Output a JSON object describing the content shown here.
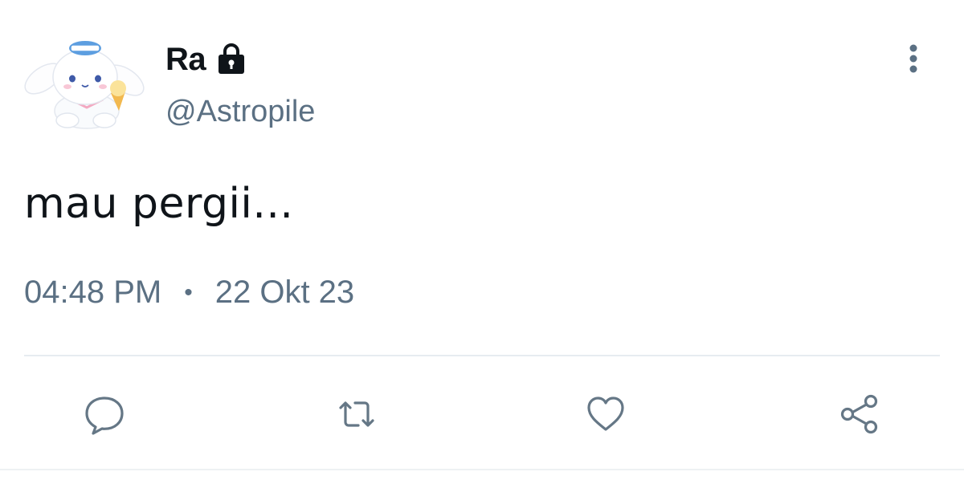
{
  "tweet": {
    "author": {
      "display_name": "Ra",
      "handle": "@Astropile",
      "avatar_icon": "cinnamoroll-avatar",
      "protected_icon": "lock-icon"
    },
    "text": "mau pergii...",
    "time": "04:48 PM",
    "separator": "•",
    "date": "22 Okt 23"
  },
  "actions": [
    {
      "name": "reply",
      "icon": "comment-icon"
    },
    {
      "name": "retweet",
      "icon": "retweet-icon"
    },
    {
      "name": "like",
      "icon": "heart-icon"
    },
    {
      "name": "share",
      "icon": "share-icon"
    }
  ],
  "colors": {
    "text_primary": "#0f1419",
    "text_secondary": "#5b7083",
    "icon": "#657786",
    "divider": "#e6ecf0"
  }
}
